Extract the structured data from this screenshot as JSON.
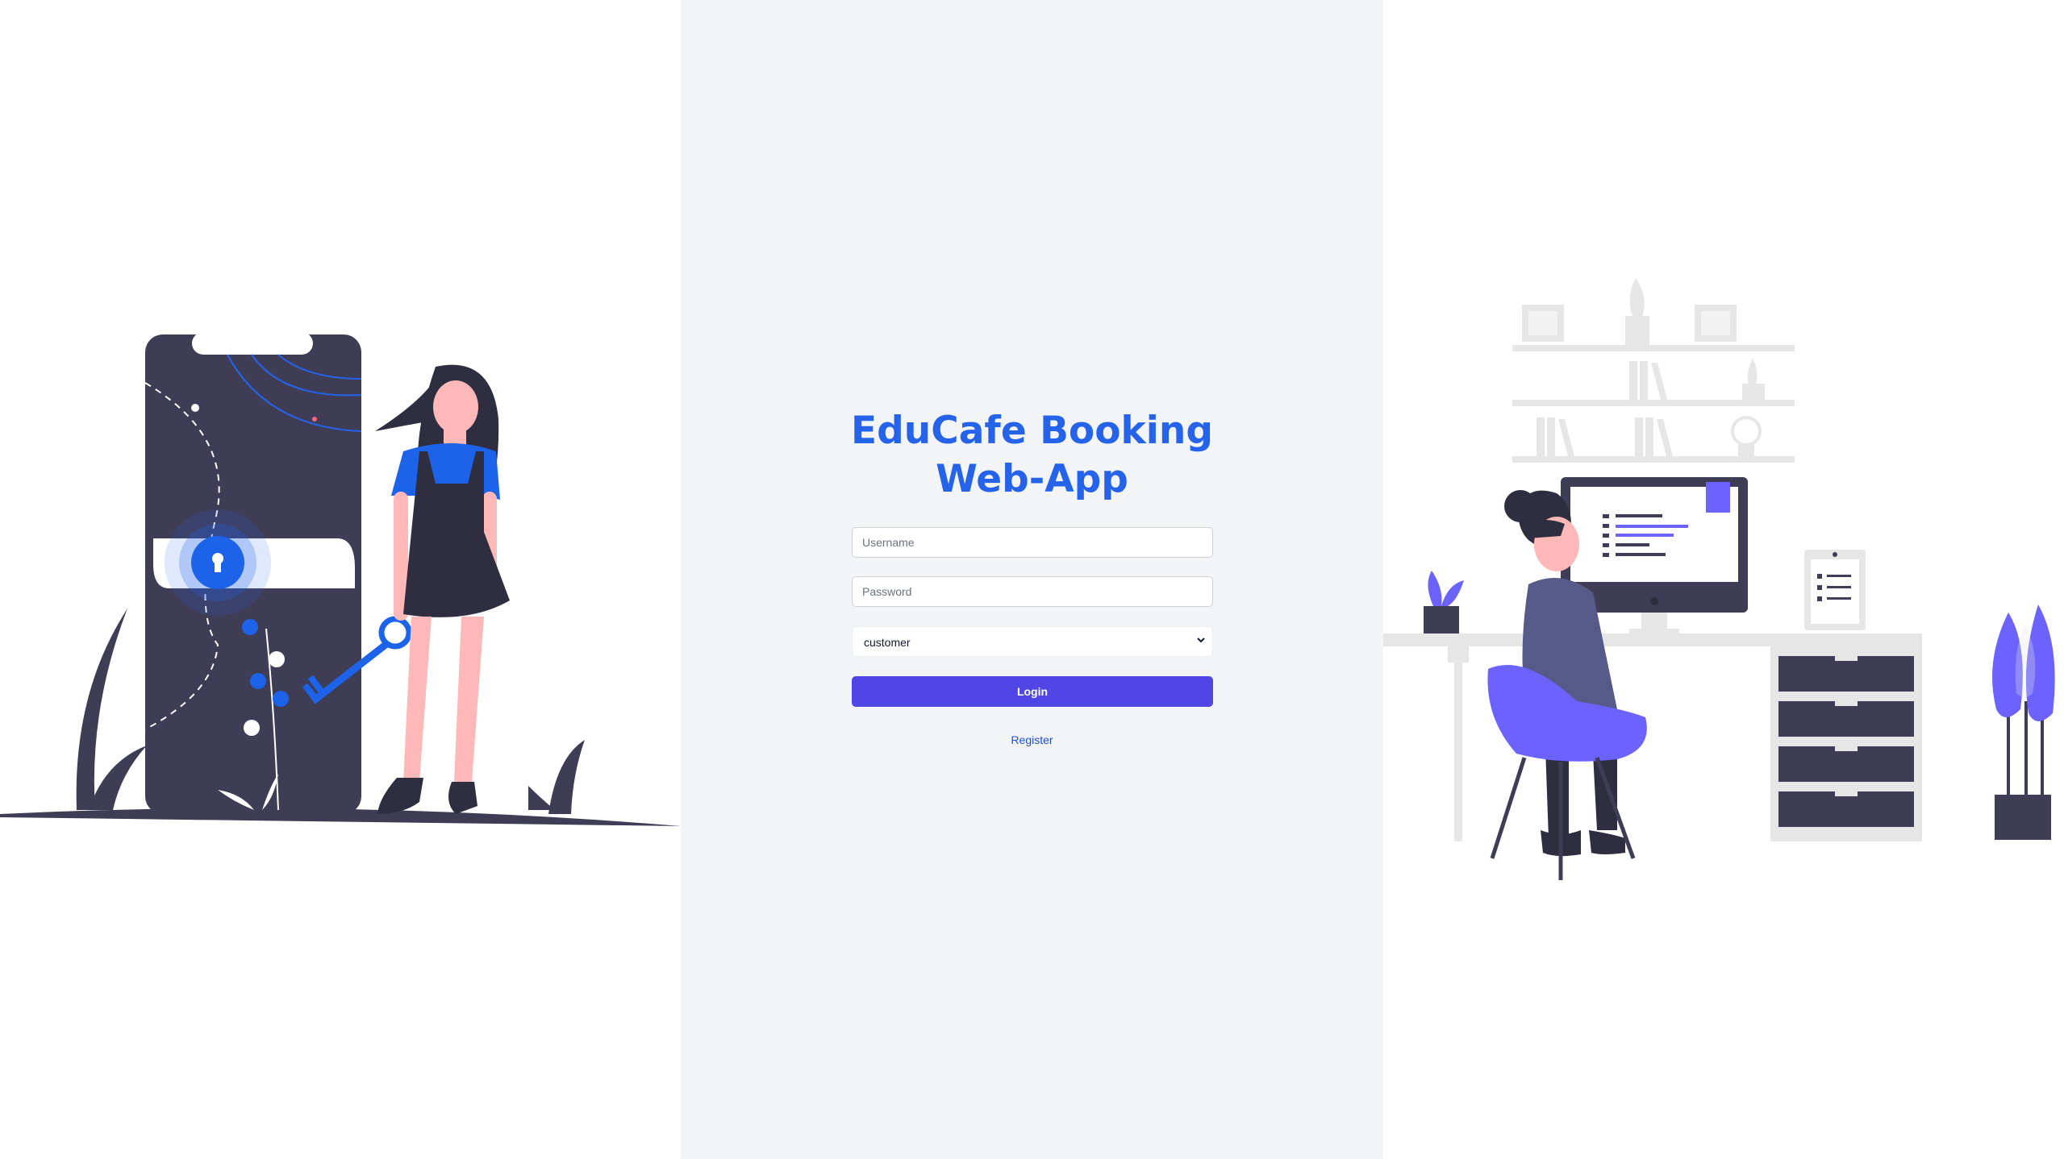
{
  "app": {
    "title_line1": "EduCafe Booking",
    "title_line2": "Web-App"
  },
  "form": {
    "username_placeholder": "Username",
    "password_placeholder": "Password",
    "role_selected": "customer",
    "login_label": "Login",
    "register_label": "Register"
  },
  "colors": {
    "accent": "#2563eb",
    "button": "#4f46e5",
    "panel_bg": "#f3f4f6"
  },
  "illustrations": {
    "left": "woman-with-key-unlocking-phone-illustration",
    "right": "woman-working-at-desk-illustration"
  }
}
